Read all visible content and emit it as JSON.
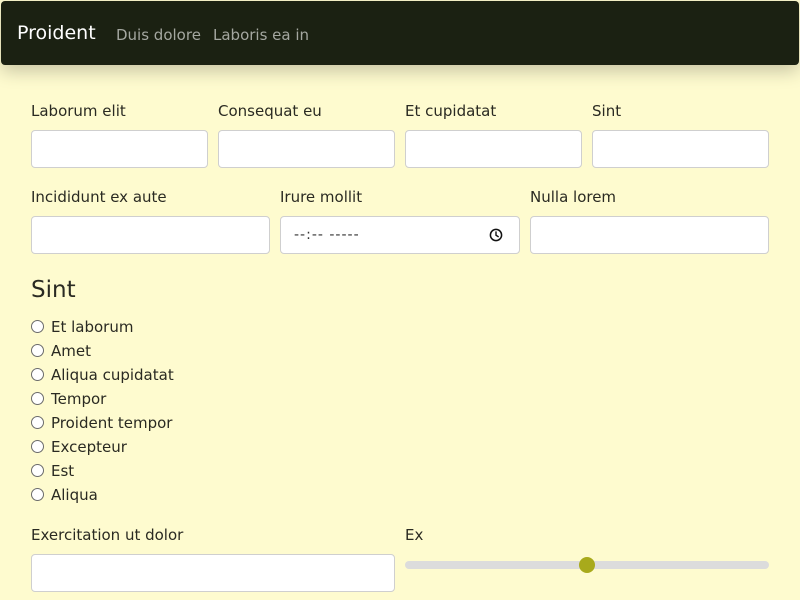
{
  "navbar": {
    "brand": "Proident",
    "links": [
      "Duis dolore",
      "Laboris ea in"
    ]
  },
  "form": {
    "row1": [
      {
        "label": "Laborum elit",
        "value": ""
      },
      {
        "label": "Consequat eu",
        "value": ""
      },
      {
        "label": "Et cupidatat",
        "value": ""
      },
      {
        "label": "Sint",
        "value": ""
      }
    ],
    "row2": [
      {
        "label": "Incididunt ex aute",
        "value": ""
      },
      {
        "label": "Irure mollit",
        "value": "--:-- -----"
      },
      {
        "label": "Nulla lorem",
        "value": ""
      }
    ],
    "radio_group": {
      "heading": "Sint",
      "options": [
        "Et laborum",
        "Amet",
        "Aliqua cupidatat",
        "Tempor",
        "Proident tempor",
        "Excepteur",
        "Est",
        "Aliqua"
      ]
    },
    "bottom": {
      "text_label": "Exercitation ut dolor",
      "text_value": "",
      "slider_label": "Ex",
      "slider_value_fraction": 0.5
    }
  },
  "colors": {
    "page_background": "#fefbcf",
    "navbar_background": "#1b2112",
    "slider_thumb": "#a8aa1c"
  }
}
